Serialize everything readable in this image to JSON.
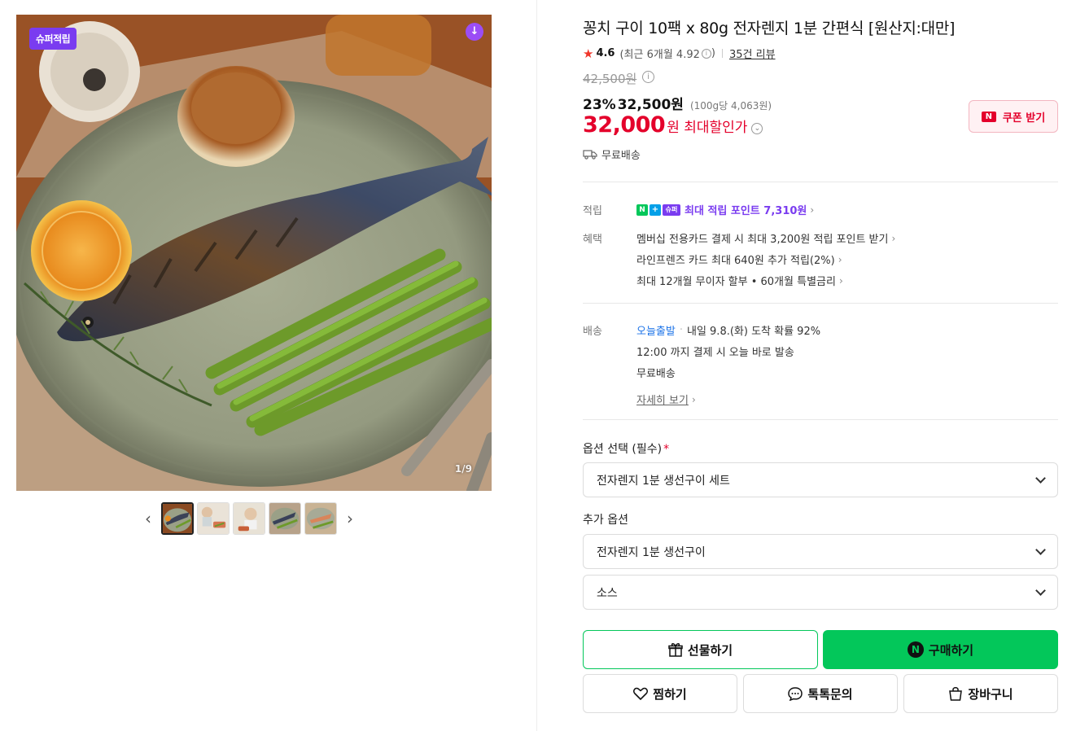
{
  "gallery": {
    "badge": "슈퍼적립",
    "page_indicator": "1/9",
    "thumbnail_count": 5,
    "active_index": 0
  },
  "product": {
    "title": "꽁치 구이 10팩 x 80g 전자렌지 1분 간편식 [원산지:대만]",
    "rating": "4.6",
    "rating_recent": "(최근 6개월 4.92",
    "review_count": "35건 리뷰",
    "original_price": "42,500원",
    "discount_pct": "23%",
    "sale_price": "32,500원",
    "unit_price": "(100g당 4,063원)",
    "max_discount_price": "32,000",
    "max_discount_label": "원 최대할인가",
    "coupon_button": "쿠폰 받기",
    "shipping": "무료배송"
  },
  "benefits": {
    "points_key": "적립",
    "points_text": "최대 적립 포인트 7,310원",
    "benefit_key": "혜택",
    "benefit_lines": [
      "멤버십 전용카드 결제 시 최대 3,200원 적립 포인트 받기",
      "라인프렌즈 카드 최대 640원 추가 적립(2%)",
      "최대 12개월 무이자 할부 • 60개월 특별금리"
    ]
  },
  "delivery": {
    "key": "배송",
    "today": "오늘출발",
    "arrival": "내일 9.8.(화) 도착 확률 92%",
    "cutoff": "12:00 까지 결제 시 오늘 바로 발송",
    "fee": "무료배송",
    "detail_link": "자세히 보기"
  },
  "options": {
    "required_label": "옵션 선택 (필수)",
    "required_value": "전자렌지 1분 생선구이 세트",
    "extra_label": "추가 옵션",
    "extra_value_1": "전자렌지 1분 생선구이",
    "extra_value_2": "소스"
  },
  "actions": {
    "gift": "선물하기",
    "buy": "구매하기",
    "wish": "찜하기",
    "talk": "톡톡문의",
    "cart": "장바구니"
  },
  "colors": {
    "naver_green": "#03c75a",
    "sale_red": "#e4002b",
    "super_purple": "#7a3cf0"
  }
}
